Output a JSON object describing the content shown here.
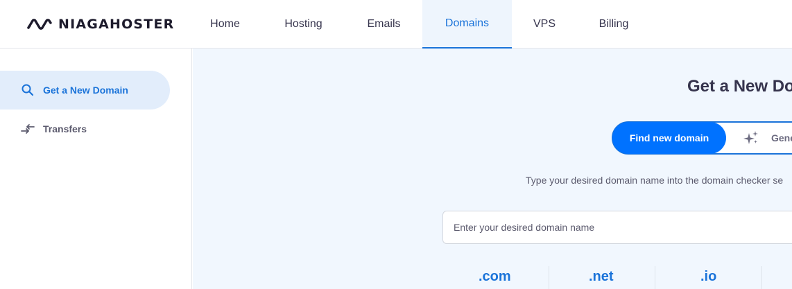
{
  "brand": {
    "name": "NIAGAHOSTER"
  },
  "nav": {
    "tabs": [
      {
        "label": "Home"
      },
      {
        "label": "Hosting"
      },
      {
        "label": "Emails"
      },
      {
        "label": "Domains",
        "active": true
      },
      {
        "label": "VPS"
      },
      {
        "label": "Billing"
      }
    ]
  },
  "sidebar": {
    "items": [
      {
        "label": "Get a New Domain",
        "icon": "search-icon",
        "active": true
      },
      {
        "label": "Transfers",
        "icon": "transfer-arrows-icon"
      }
    ]
  },
  "main": {
    "title": "Get a New Do",
    "toggle": {
      "active_label": "Find new domain",
      "inactive_label": "Gene",
      "inactive_icon": "sparkles-icon"
    },
    "helper_text": "Type your desired domain name into the domain checker se",
    "search": {
      "placeholder": "Enter your desired domain name",
      "value": ""
    },
    "tlds": [
      ".com",
      ".net",
      ".io"
    ]
  },
  "colors": {
    "accent": "#1a73d9",
    "primary_button": "#0072ff",
    "main_background": "#f1f7fe",
    "active_item_background": "#e2edfb"
  }
}
